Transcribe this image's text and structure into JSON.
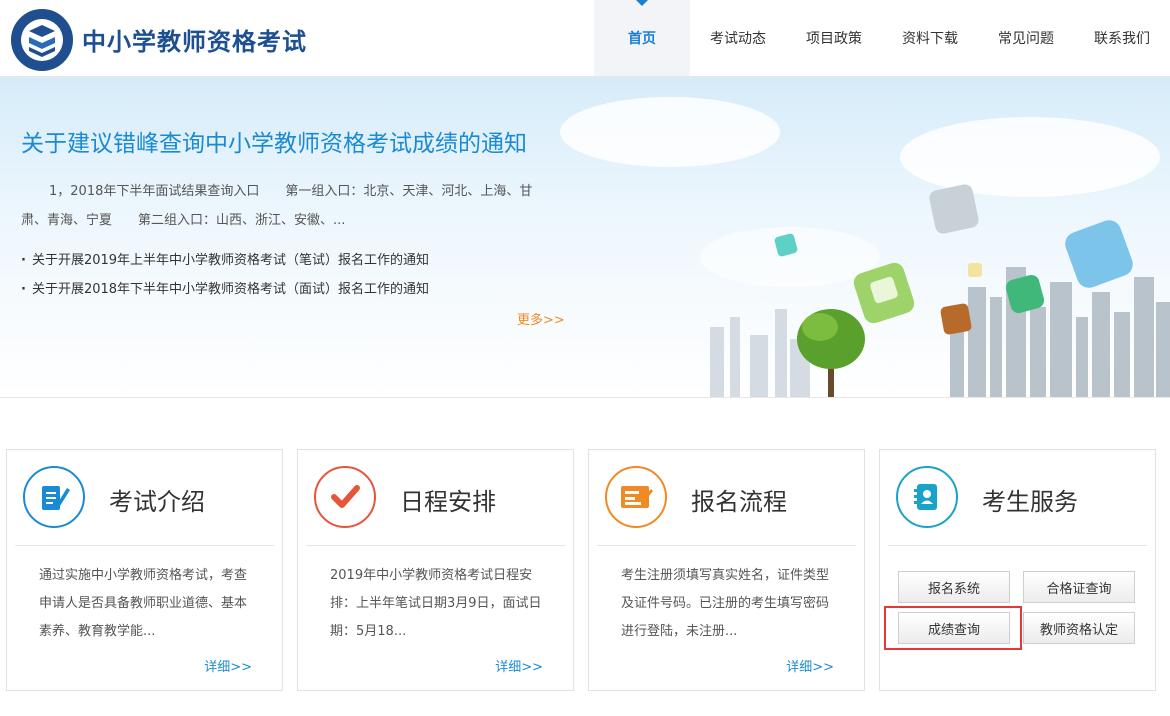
{
  "header": {
    "site_title": "中小学教师资格考试",
    "nav": [
      {
        "label": "首页",
        "active": true
      },
      {
        "label": "考试动态",
        "active": false
      },
      {
        "label": "项目政策",
        "active": false
      },
      {
        "label": "资料下载",
        "active": false
      },
      {
        "label": "常见问题",
        "active": false
      },
      {
        "label": "联系我们",
        "active": false
      }
    ]
  },
  "banner": {
    "headline": "关于建议错峰查询中小学教师资格考试成绩的通知",
    "summary": "1，2018年下半年面试结果查询入口　　第一组入口：北京、天津、河北、上海、甘肃、青海、宁夏　　第二组入口：山西、浙江、安徽、...",
    "news": [
      "关于开展2019年上半年中小学教师资格考试（笔试）报名工作的通知",
      "关于开展2018年下半年中小学教师资格考试（面试）报名工作的通知"
    ],
    "more": "更多>>"
  },
  "cards": [
    {
      "title": "考试介绍",
      "text": "通过实施中小学教师资格考试，考查申请人是否具备教师职业道德、基本素养、教育教学能...",
      "more": "详细>>",
      "icon": "document-pen-icon",
      "color": "#1a8ad4"
    },
    {
      "title": "日程安排",
      "text": "2019年中小学教师资格考试日程安排：上半年笔试日期3月9日，面试日期：5月18...",
      "more": "详细>>",
      "icon": "checkmark-icon",
      "color": "#e8543a"
    },
    {
      "title": "报名流程",
      "text": "考生注册须填写真实姓名，证件类型及证件号码。已注册的考生填写密码进行登陆，未注册...",
      "more": "详细>>",
      "icon": "form-icon",
      "color": "#f08a24"
    },
    {
      "title": "考生服务",
      "icon": "contact-card-icon",
      "color": "#1aa3c8"
    }
  ],
  "services": {
    "buttons": [
      "报名系统",
      "合格证查询",
      "成绩查询",
      "教师资格认定"
    ]
  }
}
